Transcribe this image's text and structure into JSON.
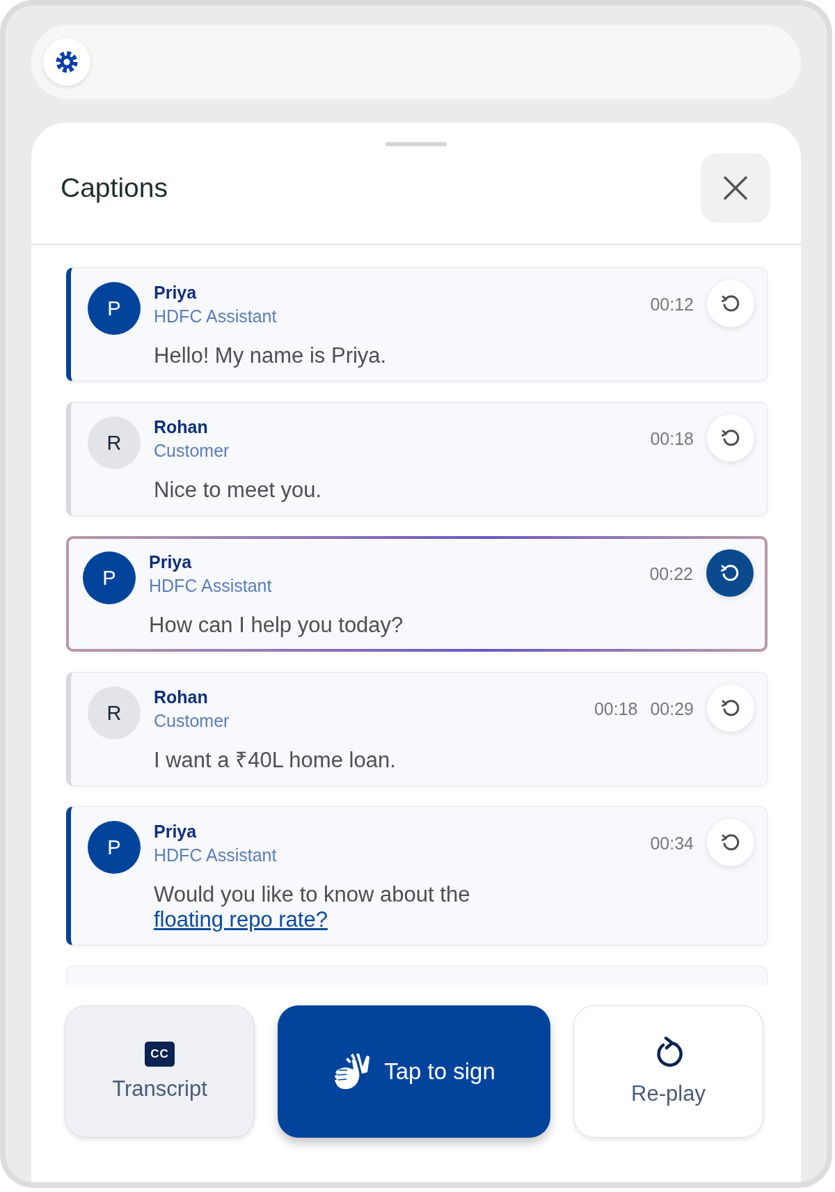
{
  "panel": {
    "title": "Captions"
  },
  "messages": [
    {
      "kind": "agent",
      "initial": "P",
      "name": "Priya",
      "role": "HDFC Assistant",
      "times": [
        "00:12"
      ],
      "text": "Hello! My name is Priya.",
      "selected": false
    },
    {
      "kind": "customer",
      "initial": "R",
      "name": "Rohan",
      "role": "Customer",
      "times": [
        "00:18"
      ],
      "text": "Nice to meet you.",
      "selected": false
    },
    {
      "kind": "agent",
      "initial": "P",
      "name": "Priya",
      "role": "HDFC Assistant",
      "times": [
        "00:22"
      ],
      "text": "How can I help you today?",
      "selected": true
    },
    {
      "kind": "customer",
      "initial": "R",
      "name": "Rohan",
      "role": "Customer",
      "times": [
        "00:18",
        "00:29"
      ],
      "text": "I want a ₹40L home loan.",
      "selected": false
    },
    {
      "kind": "agent",
      "initial": "P",
      "name": "Priya",
      "role": "HDFC Assistant",
      "times": [
        "00:34"
      ],
      "text": "Would you like to know about the",
      "link": "floating repo rate?",
      "selected": false
    }
  ],
  "actions": [
    {
      "kind": "transcript",
      "icon_text": "CC",
      "label": "Transcript"
    },
    {
      "kind": "sign",
      "label": "Tap to sign"
    },
    {
      "kind": "replay",
      "label": "Re-play"
    }
  ]
}
